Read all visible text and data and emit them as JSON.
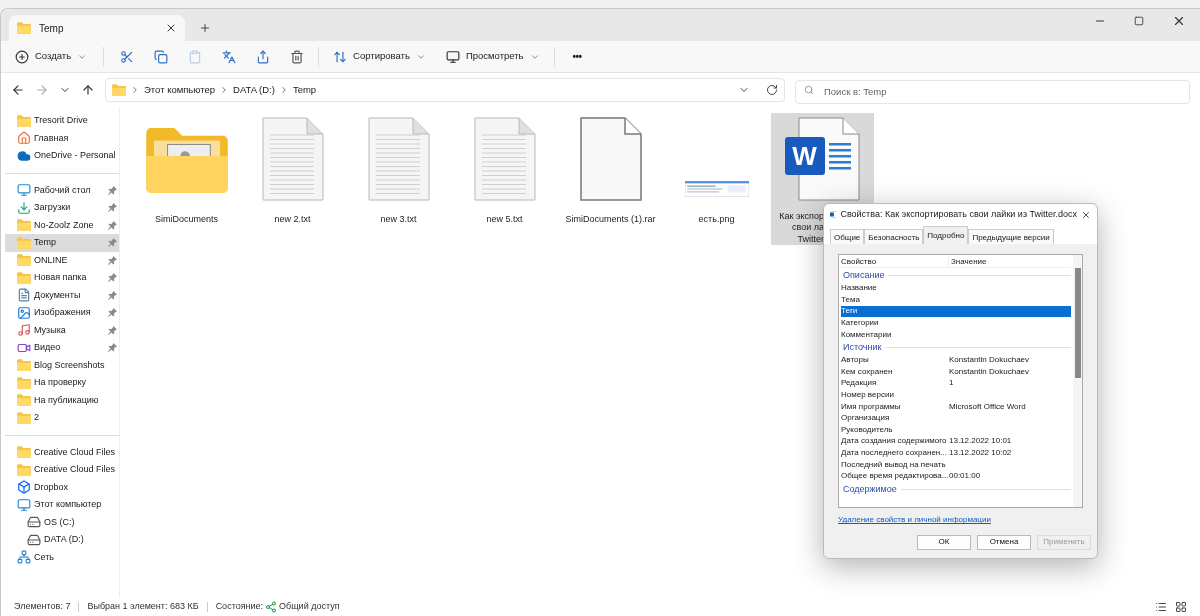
{
  "tab": {
    "title": "Temp"
  },
  "toolbar": {
    "create": "Создать",
    "sort": "Сортировать",
    "view": "Просмотреть",
    "more": "•••"
  },
  "address": {
    "crumbs": [
      "Этот компьютер",
      "DATA (D:)",
      "Temp"
    ],
    "search_placeholder": "Поиск в: Temp"
  },
  "sidebar": {
    "groups": [
      [
        {
          "label": "Tresorit Drive",
          "kind": "folder",
          "pinned": false,
          "selected": false
        },
        {
          "label": "Главная",
          "kind": "home",
          "pinned": false,
          "selected": false
        },
        {
          "label": "OneDrive - Personal",
          "kind": "cloud",
          "pinned": false,
          "selected": false
        }
      ],
      [
        {
          "label": "Рабочий стол",
          "kind": "desktop",
          "pinned": true,
          "selected": false
        },
        {
          "label": "Загрузки",
          "kind": "download",
          "pinned": true,
          "selected": false
        },
        {
          "label": "No-Zoolz Zone",
          "kind": "folder",
          "pinned": true,
          "selected": false
        },
        {
          "label": "Temp",
          "kind": "folder",
          "pinned": true,
          "selected": true
        },
        {
          "label": "ONLINE",
          "kind": "folder",
          "pinned": true,
          "selected": false
        },
        {
          "label": "Новая папка",
          "kind": "folder",
          "pinned": true,
          "selected": false
        },
        {
          "label": "Документы",
          "kind": "doc",
          "pinned": true,
          "selected": false
        },
        {
          "label": "Изображения",
          "kind": "image",
          "pinned": true,
          "selected": false
        },
        {
          "label": "Музыка",
          "kind": "music",
          "pinned": true,
          "selected": false
        },
        {
          "label": "Видео",
          "kind": "video",
          "pinned": true,
          "selected": false
        },
        {
          "label": "Blog Screenshots",
          "kind": "folder",
          "pinned": false,
          "selected": false
        },
        {
          "label": "На проверку",
          "kind": "folder",
          "pinned": false,
          "selected": false
        },
        {
          "label": "На публикацию",
          "kind": "folder",
          "pinned": false,
          "selected": false
        },
        {
          "label": "2",
          "kind": "folder",
          "pinned": false,
          "selected": false
        }
      ],
      [
        {
          "label": "Creative Cloud Files",
          "kind": "folder",
          "pinned": false,
          "selected": false
        },
        {
          "label": "Creative Cloud Files",
          "kind": "folder",
          "pinned": false,
          "selected": false
        },
        {
          "label": "Dropbox",
          "kind": "dropbox",
          "pinned": false,
          "selected": false
        },
        {
          "label": "Этот компьютер",
          "kind": "pc",
          "pinned": false,
          "selected": false,
          "children": [
            {
              "label": "OS (C:)",
              "kind": "drive",
              "pinned": false,
              "selected": false
            },
            {
              "label": "DATA (D:)",
              "kind": "drive",
              "pinned": false,
              "selected": false
            }
          ]
        },
        {
          "label": "Сеть",
          "kind": "network",
          "pinned": false,
          "selected": false
        }
      ]
    ]
  },
  "files": [
    {
      "kind": "folder",
      "lines": [
        "SimiDocuments"
      ],
      "selected": false
    },
    {
      "kind": "text",
      "lines": [
        "new 2.txt"
      ],
      "selected": false
    },
    {
      "kind": "text",
      "lines": [
        "new 3.txt"
      ],
      "selected": false
    },
    {
      "kind": "text",
      "lines": [
        "new 5.txt"
      ],
      "selected": false
    },
    {
      "kind": "blank",
      "lines": [
        "SimiDocuments (1).rar"
      ],
      "selected": false
    },
    {
      "kind": "image",
      "lines": [
        "есть.png"
      ],
      "selected": false
    },
    {
      "kind": "word",
      "badge": "W",
      "lines": [
        "Как экспор",
        "свои ла",
        "Twitter"
      ],
      "selected": true
    }
  ],
  "dialog": {
    "title": "Свойства: Как экспортировать свои лайки из Twitter.docx",
    "tabs": [
      {
        "label": "Общие",
        "selected": false
      },
      {
        "label": "Безопасность",
        "selected": false
      },
      {
        "label": "Подробно",
        "selected": true
      },
      {
        "label": "Предыдущие версии",
        "selected": false
      }
    ],
    "columns": [
      "Свойство",
      "Значение"
    ],
    "rows": [
      {
        "kind": "group",
        "name": "Описание"
      },
      {
        "kind": "prop",
        "name": "Название",
        "selected": false
      },
      {
        "kind": "prop",
        "name": "Тема",
        "selected": false
      },
      {
        "kind": "prop",
        "name": "Теги",
        "selected": true
      },
      {
        "kind": "prop",
        "name": "Категории",
        "selected": false
      },
      {
        "kind": "prop",
        "name": "Комментарии",
        "selected": false
      },
      {
        "kind": "group",
        "name": "Источник"
      },
      {
        "kind": "prop",
        "name": "Авторы",
        "value": "Konstantin Dokuchaev",
        "selected": false
      },
      {
        "kind": "prop",
        "name": "Кем сохранен",
        "value": "Konstantin Dokuchaev",
        "selected": false
      },
      {
        "kind": "prop",
        "name": "Редакция",
        "value": "1",
        "selected": false
      },
      {
        "kind": "prop",
        "name": "Номер версии",
        "selected": false
      },
      {
        "kind": "prop",
        "name": "Имя программы",
        "value": "Microsoft Office Word",
        "selected": false
      },
      {
        "kind": "prop",
        "name": "Организация",
        "selected": false
      },
      {
        "kind": "prop",
        "name": "Руководитель",
        "selected": false
      },
      {
        "kind": "prop",
        "name": "Дата создания содержимого",
        "value": "13.12.2022 10:01",
        "selected": false
      },
      {
        "kind": "prop",
        "name": "Дата последнего сохранен...",
        "value": "13.12.2022 10:02",
        "selected": false
      },
      {
        "kind": "prop",
        "name": "Последний вывод на печать",
        "selected": false
      },
      {
        "kind": "prop",
        "name": "Общее время редактирова...",
        "value": "00:01:00",
        "selected": false
      },
      {
        "kind": "group",
        "name": "Содержимое"
      }
    ],
    "link": "Удаление свойств и личной информации",
    "buttons": [
      {
        "label": "ОК",
        "disabled": false
      },
      {
        "label": "Отмена",
        "disabled": false
      },
      {
        "label": "Применить",
        "disabled": true
      }
    ]
  },
  "status_bar": {
    "count": "Элементов: 7",
    "selection": "Выбран 1 элемент: 683 КБ",
    "state_label": "Состояние:",
    "state": "Общий доступ"
  }
}
